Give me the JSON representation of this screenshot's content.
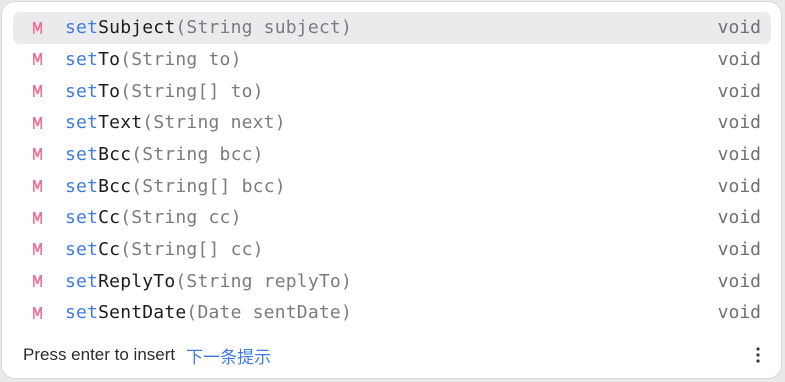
{
  "completion": {
    "icon": "method-icon",
    "accent_color": "#3f7be8",
    "icon_color": "#f0729a",
    "items": [
      {
        "prefix": "set",
        "name": "Subject",
        "params": "(String subject)",
        "ret": "void",
        "selected": true
      },
      {
        "prefix": "set",
        "name": "To",
        "params": "(String to)",
        "ret": "void"
      },
      {
        "prefix": "set",
        "name": "To",
        "params": "(String[] to)",
        "ret": "void"
      },
      {
        "prefix": "set",
        "name": "Text",
        "params": "(String next)",
        "ret": "void"
      },
      {
        "prefix": "set",
        "name": "Bcc",
        "params": "(String bcc)",
        "ret": "void"
      },
      {
        "prefix": "set",
        "name": "Bcc",
        "params": "(String[] bcc)",
        "ret": "void"
      },
      {
        "prefix": "set",
        "name": "Cc",
        "params": "(String cc)",
        "ret": "void"
      },
      {
        "prefix": "set",
        "name": "Cc",
        "params": "(String[] cc)",
        "ret": "void"
      },
      {
        "prefix": "set",
        "name": "ReplyTo",
        "params": "(String replyTo)",
        "ret": "void"
      },
      {
        "prefix": "set",
        "name": "SentDate",
        "params": "(Date sentDate)",
        "ret": "void"
      }
    ]
  },
  "footer": {
    "hint": "Press enter to insert",
    "next_tip": "下一条提示",
    "more_icon": "more-vertical-icon"
  }
}
